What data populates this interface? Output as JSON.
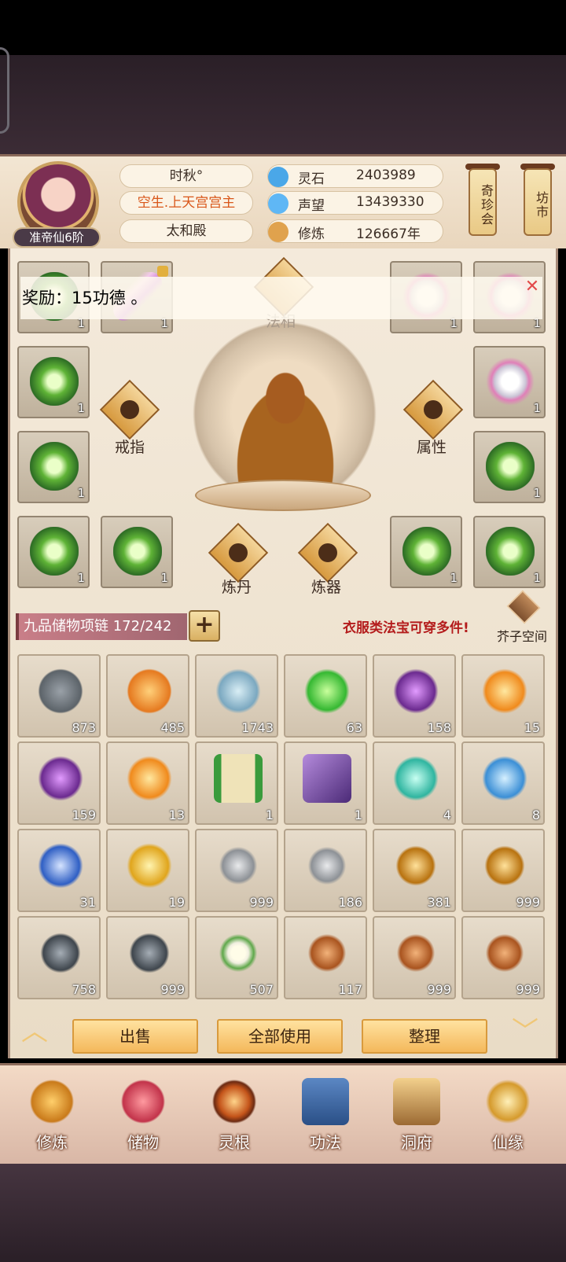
{
  "header": {
    "rank": "准帝仙6阶",
    "name": "时秋°",
    "title": "空生.上天宫宫主",
    "location": "太和殿",
    "resources": [
      {
        "label": "灵石",
        "value": "2403989",
        "icon": "spirit-stone-icon",
        "color": "#4aa7e8"
      },
      {
        "label": "声望",
        "value": "13439330",
        "icon": "reputation-icon",
        "color": "#5fb7f5"
      },
      {
        "label": "修炼",
        "value": "126667年",
        "icon": "cultivation-icon",
        "color": "#e0a24d"
      }
    ],
    "side_buttons": [
      "奇珍会",
      "坊市"
    ]
  },
  "notice": {
    "text": "奖励：15功德 。"
  },
  "equipment": {
    "center_label": "法相",
    "ring_label": "戒指",
    "attr_label": "属性",
    "alchemy_label": "炼丹",
    "forge_label": "炼器",
    "slots": [
      {
        "count": "1"
      },
      {
        "count": "1"
      },
      {
        "count": "1"
      },
      {
        "count": "1"
      },
      {
        "count": "1"
      },
      {
        "count": "1"
      },
      {
        "count": "1"
      },
      {
        "count": "1"
      },
      {
        "count": "1"
      },
      {
        "count": "1"
      },
      {
        "count": "1"
      },
      {
        "count": "1"
      }
    ]
  },
  "storage": {
    "name": "九品储物项链",
    "capacity": "172/242",
    "tip": "衣服类法宝可穿多件!",
    "space_label": "芥子空间",
    "items": [
      {
        "count": "873"
      },
      {
        "count": "485"
      },
      {
        "count": "1743"
      },
      {
        "count": "63"
      },
      {
        "count": "158"
      },
      {
        "count": "15"
      },
      {
        "count": "159"
      },
      {
        "count": "13"
      },
      {
        "count": "1"
      },
      {
        "count": "1"
      },
      {
        "count": "4"
      },
      {
        "count": "8"
      },
      {
        "count": "31"
      },
      {
        "count": "19"
      },
      {
        "count": "999"
      },
      {
        "count": "186"
      },
      {
        "count": "381"
      },
      {
        "count": "999"
      },
      {
        "count": "758"
      },
      {
        "count": "999"
      },
      {
        "count": "507"
      },
      {
        "count": "117"
      },
      {
        "count": "999"
      },
      {
        "count": "999"
      }
    ]
  },
  "actions": {
    "sell": "出售",
    "use_all": "全部使用",
    "sort": "整理"
  },
  "nav": [
    {
      "label": "修炼"
    },
    {
      "label": "储物"
    },
    {
      "label": "灵根"
    },
    {
      "label": "功法"
    },
    {
      "label": "洞府"
    },
    {
      "label": "仙缘"
    }
  ]
}
